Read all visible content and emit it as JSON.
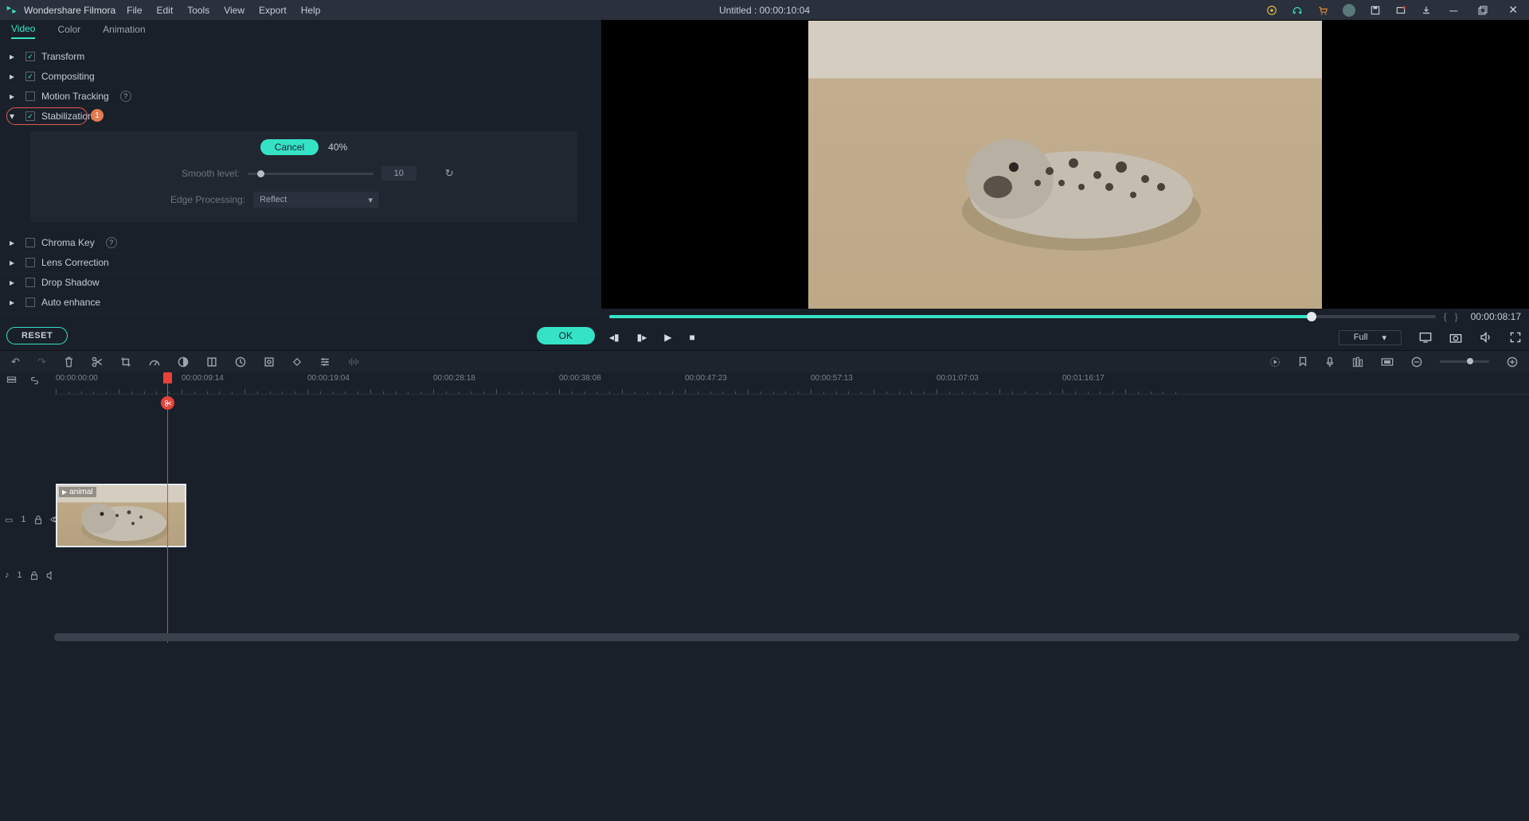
{
  "titlebar": {
    "app_name": "Wondershare Filmora",
    "menus": [
      "File",
      "Edit",
      "Tools",
      "View",
      "Export",
      "Help"
    ],
    "document_title": "Untitled : 00:00:10:04"
  },
  "tabs": {
    "video": "Video",
    "color": "Color",
    "animation": "Animation"
  },
  "properties": {
    "transform": "Transform",
    "compositing": "Compositing",
    "motion_tracking": "Motion Tracking",
    "stabilization": "Stabilization",
    "chroma_key": "Chroma Key",
    "lens_correction": "Lens Correction",
    "drop_shadow": "Drop Shadow",
    "auto_enhance": "Auto enhance"
  },
  "stabilization": {
    "badge": "1",
    "cancel": "Cancel",
    "progress": "40%",
    "smooth_label": "Smooth level:",
    "smooth_value": "10",
    "edge_label": "Edge Processing:",
    "edge_value": "Reflect"
  },
  "buttons": {
    "reset": "RESET",
    "ok": "OK"
  },
  "preview": {
    "timecode": "00:00:08:17",
    "quality": "Full"
  },
  "timeline": {
    "ticks": [
      "00:00:00:00",
      "00:00:09:14",
      "00:00:19:04",
      "00:00:28:18",
      "00:00:38:08",
      "00:00:47:23",
      "00:00:57:13",
      "00:01:07:03",
      "00:01:16:17"
    ],
    "clip_name": "animal",
    "video_track": "1",
    "audio_track": "1"
  }
}
